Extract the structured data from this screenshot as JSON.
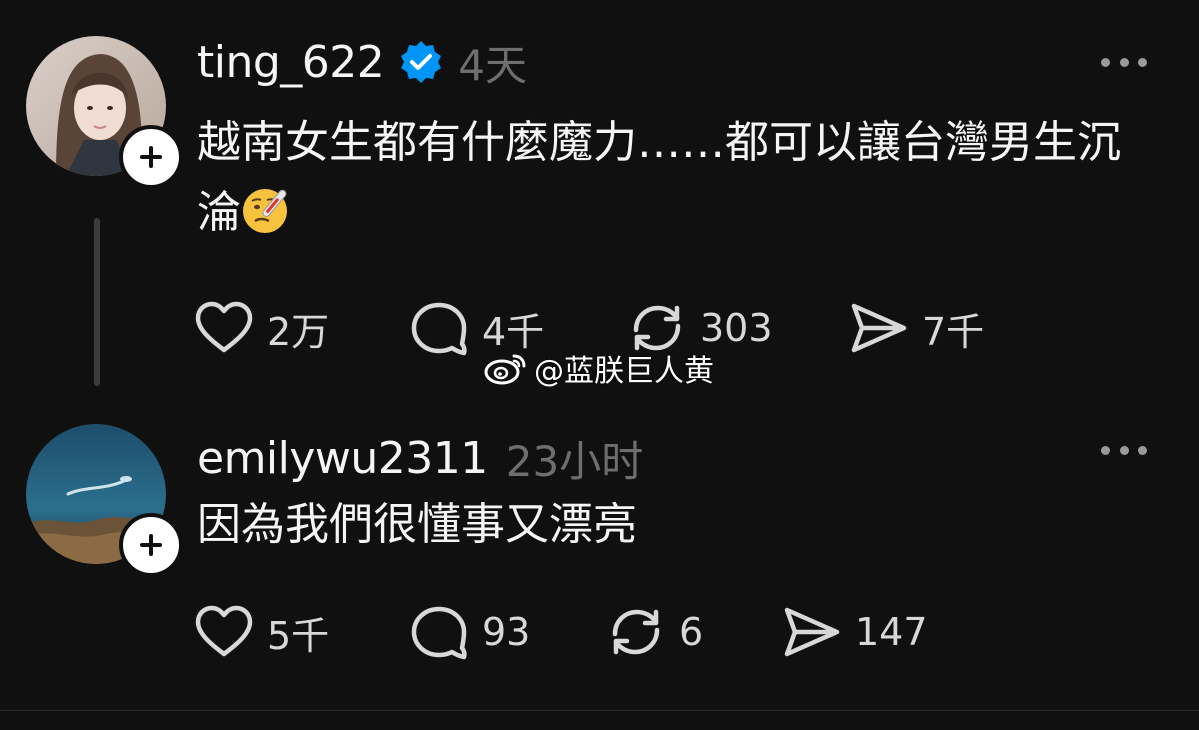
{
  "posts": [
    {
      "username": "ting_622",
      "verified": true,
      "time": "4天",
      "text": "越南女生都有什麼魔力……都可以讓台灣男生沉淪",
      "emoji": "face-with-thermometer",
      "likes": "2万",
      "comments": "4千",
      "reposts": "303",
      "shares": "7千"
    },
    {
      "username": "emilywu2311",
      "verified": false,
      "time": "23小时",
      "text": "因為我們很懂事又漂亮",
      "likes": "5千",
      "comments": "93",
      "reposts": "6",
      "shares": "147"
    }
  ],
  "watermark": {
    "text": "@蓝朕巨人黄",
    "icon": "weibo-icon"
  },
  "colors": {
    "background": "#101010",
    "text": "#f3f5f7",
    "muted": "#6e6e6e",
    "verified": "#0095f6",
    "thread_line": "#3b3b3b"
  }
}
